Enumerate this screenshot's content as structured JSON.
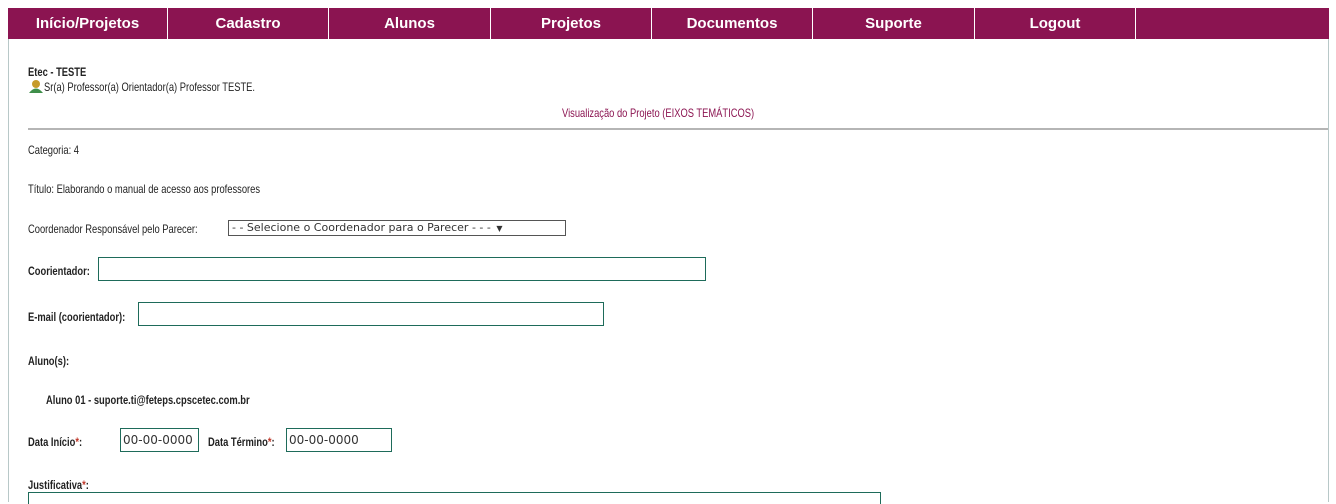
{
  "nav": {
    "items": [
      "Início/Projetos",
      "Cadastro",
      "Alunos",
      "Projetos",
      "Documentos",
      "Suporte",
      "Logout",
      ""
    ]
  },
  "header": {
    "school": "Etec - TESTE",
    "teacher": "Sr(a) Professor(a) Orientador(a) Professor TESTE.",
    "view_title": "Visualização do Projeto (EIXOS TEMÁTICOS)"
  },
  "form": {
    "categoria": "Categoria: 4",
    "titulo": "Título: Elaborando o manual de acesso aos professores",
    "coordenador_label": "Coordenador Responsável pelo Parecer:",
    "coordenador_select": "- - Selecione o Coordenador para o Parecer - - -",
    "coorientador_label": "Coorientador:",
    "coorientador_value": "",
    "email_label": "E-mail (coorientador):",
    "email_value": "",
    "alunos_label": "Aluno(s):",
    "aluno_1": "Aluno 01 - suporte.ti@feteps.cpscetec.com.br",
    "data_inicio_label": "Data Início",
    "data_inicio_value": "00-00-0000",
    "data_termino_label": "Data Término",
    "data_termino_value": "00-00-0000",
    "justificativa_label": "Justificativa",
    "required_mark": "*",
    "colon": ":"
  },
  "colors": {
    "nav_bg": "#8b1451",
    "field_border": "#1e6b5a",
    "title_color": "#8b1451"
  }
}
